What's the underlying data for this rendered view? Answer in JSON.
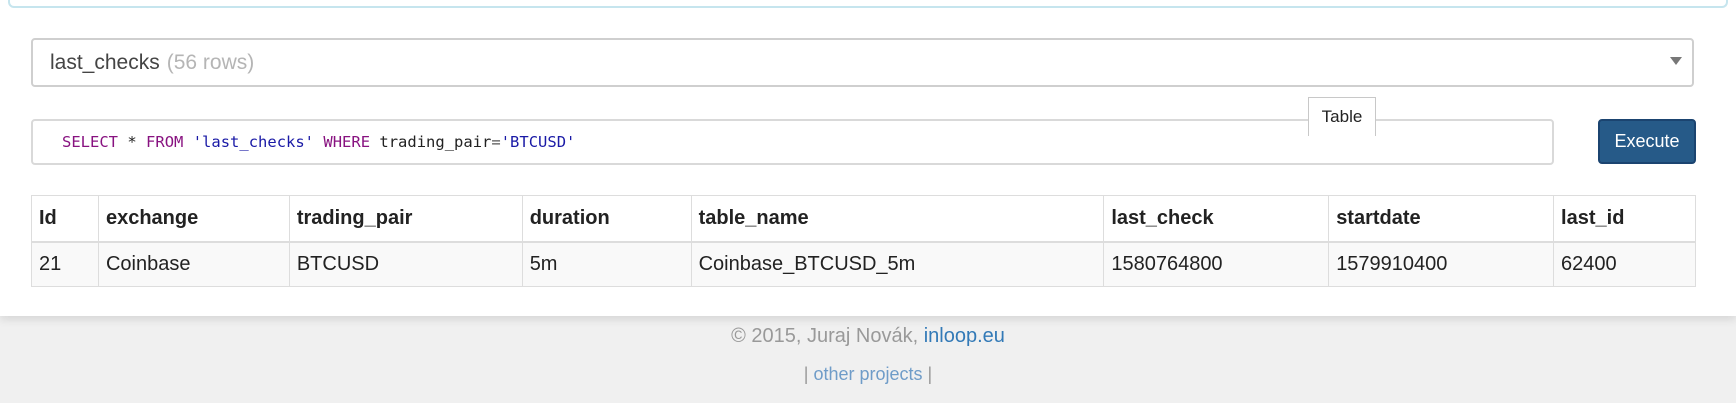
{
  "table_select": {
    "selected": "last_checks",
    "row_count": "(56 rows)"
  },
  "query": {
    "select_kw": "SELECT",
    "star": "*",
    "from_kw": "FROM",
    "table_literal": "'last_checks'",
    "where_kw": "WHERE",
    "column": "trading_pair",
    "equals": "=",
    "value_literal": "'BTCUSD'"
  },
  "tooltip_tab": "Table",
  "execute_label": "Execute",
  "results": {
    "columns": [
      "Id",
      "exchange",
      "trading_pair",
      "duration",
      "table_name",
      "last_check",
      "startdate",
      "last_id"
    ],
    "rows": [
      [
        "21",
        "Coinbase",
        "BTCUSD",
        "5m",
        "Coinbase_BTCUSD_5m",
        "1580764800",
        "1579910400",
        "62400"
      ]
    ]
  },
  "footer": {
    "copyright": "© 2015, Juraj Novák,",
    "site_link": "inloop.eu",
    "sep_left": "|",
    "projects_link": "other projects",
    "sep_right": "|"
  }
}
